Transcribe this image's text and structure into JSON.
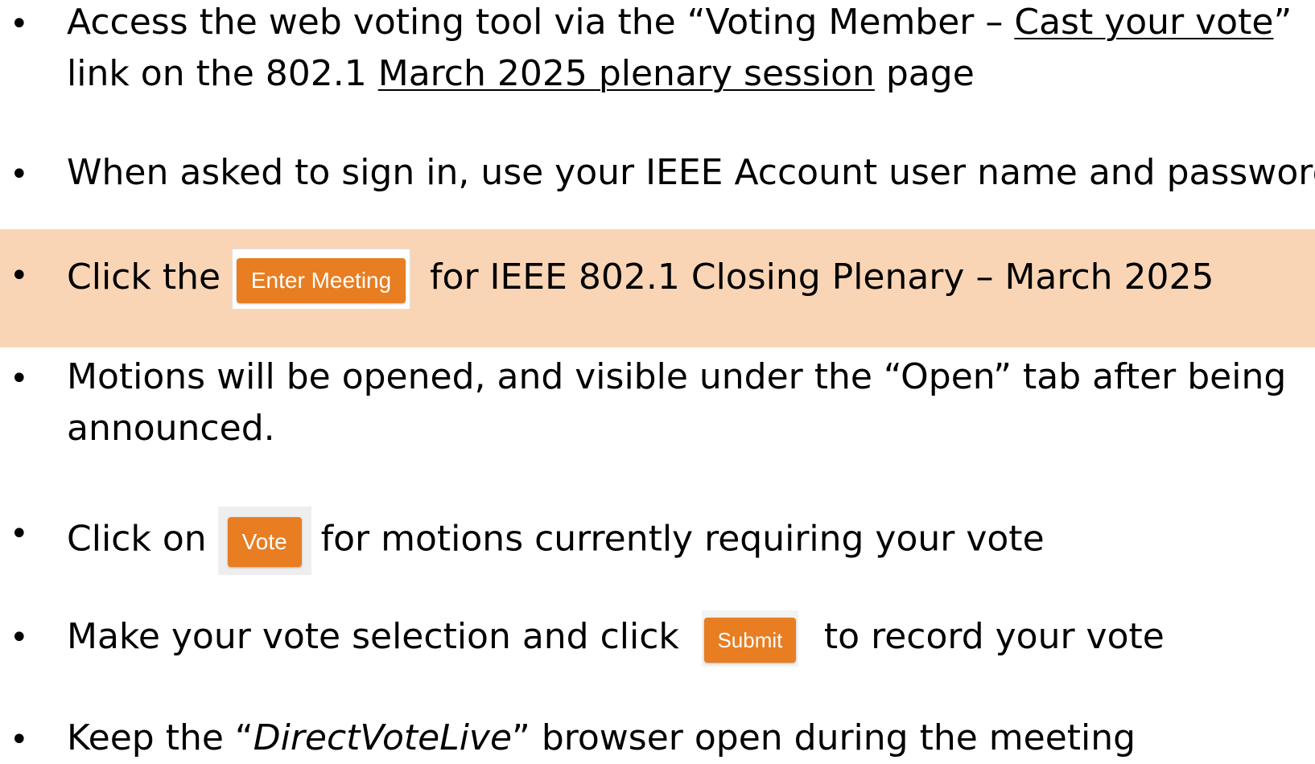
{
  "items": [
    {
      "line1_a": "Access the web voting tool via the “Voting Member – ",
      "line1_link": "Cast your vote",
      "line1_b": "”",
      "line2_a": "link on the 802.1 ",
      "line2_link": "March 2025 plenary session",
      "line2_b": " page"
    },
    {
      "text": "When asked to sign in, use your IEEE Account user name and password"
    },
    {
      "before": "Click the",
      "button": "Enter Meeting",
      "after": "for IEEE 802.1 Closing Plenary – March 2025",
      "highlight_color": "#fad5b5"
    },
    {
      "line1": "Motions will be opened, and visible under the “Open” tab after being",
      "line2": "announced."
    },
    {
      "before": "Click on",
      "button": "Vote",
      "after": "for motions currently requiring your vote"
    },
    {
      "before": "Make your vote selection and click",
      "button": "Submit",
      "after": "to record your vote"
    },
    {
      "before": "Keep the “",
      "italic": "DirectVoteLive",
      "after": "” browser open during the meeting"
    }
  ],
  "bullet_char": "•",
  "button_color": "#e87d22"
}
